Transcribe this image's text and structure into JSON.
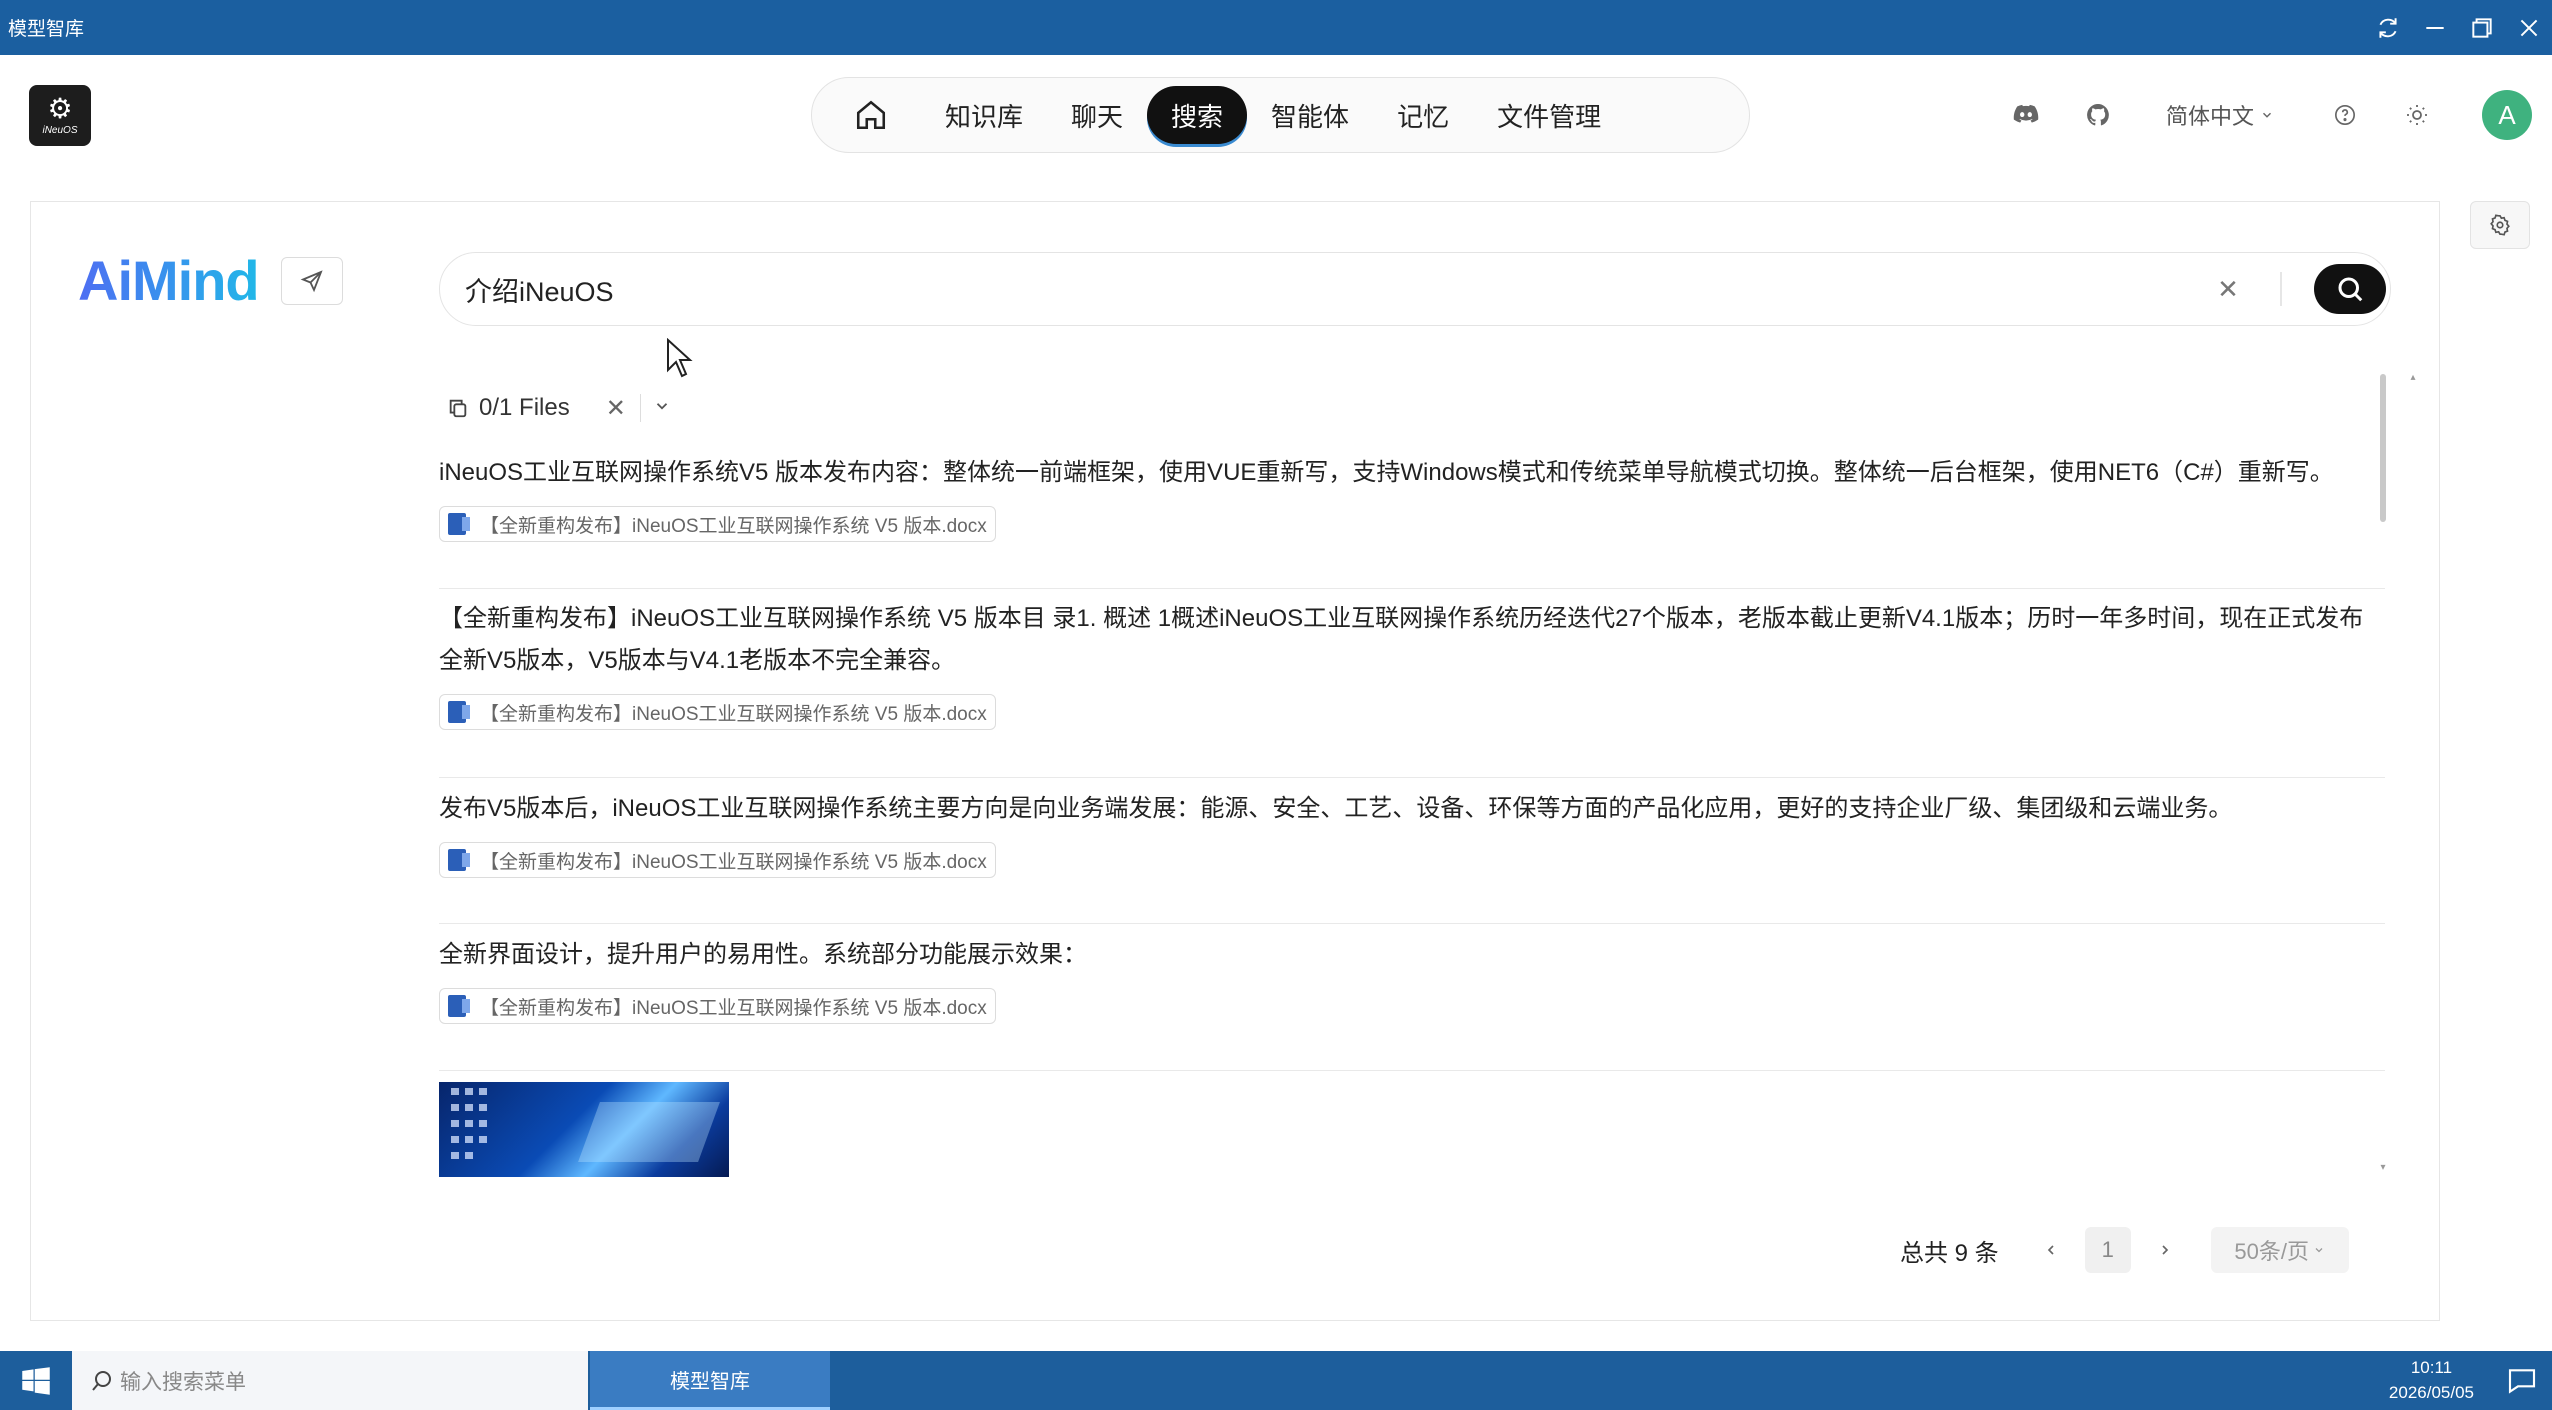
{
  "window": {
    "title": "模型智库",
    "controls": [
      "refresh-icon",
      "minimize-icon",
      "restore-icon",
      "close-icon"
    ]
  },
  "header": {
    "logo_text": "iNeuOS",
    "nav": [
      {
        "key": "home",
        "label": "",
        "icon": "home-icon",
        "active": false
      },
      {
        "key": "knowledge",
        "label": "知识库",
        "active": false
      },
      {
        "key": "chat",
        "label": "聊天",
        "active": false
      },
      {
        "key": "search",
        "label": "搜索",
        "active": true
      },
      {
        "key": "agents",
        "label": "智能体",
        "active": false
      },
      {
        "key": "memory",
        "label": "记忆",
        "active": false
      },
      {
        "key": "files",
        "label": "文件管理",
        "active": false
      }
    ],
    "language": "简体中文",
    "avatar_letter": "A"
  },
  "search": {
    "brand": "AiMind",
    "query": "介绍iNeuOS",
    "files_label": "0/1  Files"
  },
  "results": [
    {
      "text": "iNeuOS工业互联网操作系统V5 版本发布内容：整体统一前端框架，使用VUE重新写，支持Windows模式和传统菜单导航模式切换。整体统一后台框架，使用NET6（C#）重新写。",
      "doc": "【全新重构发布】iNeuOS工业互联网操作系统 V5 版本.docx"
    },
    {
      "text": "【全新重构发布】iNeuOS工业互联网操作系统 V5 版本目 录1. 概述 1概述iNeuOS工业互联网操作系统历经迭代27个版本，老版本截止更新V4.1版本；历时一年多时间，现在正式发布全新V5版本，V5版本与V4.1老版本不完全兼容。",
      "doc": "【全新重构发布】iNeuOS工业互联网操作系统 V5 版本.docx"
    },
    {
      "text": "发布V5版本后，iNeuOS工业互联网操作系统主要方向是向业务端发展：能源、安全、工艺、设备、环保等方面的产品化应用，更好的支持企业厂级、集团级和云端业务。",
      "doc": "【全新重构发布】iNeuOS工业互联网操作系统 V5 版本.docx"
    },
    {
      "text": "全新界面设计，提升用户的易用性。系统部分功能展示效果：",
      "doc": "【全新重构发布】iNeuOS工业互联网操作系统 V5 版本.docx"
    }
  ],
  "pagination": {
    "total": "总共 9 条",
    "page": "1",
    "page_size": "50条/页"
  },
  "taskbar": {
    "search_placeholder": "输入搜索菜单",
    "app": "模型智库",
    "time": "10:11",
    "date": "2026/05/05"
  },
  "colors": {
    "titlebar": "#1b5fa0",
    "taskbar": "#1d5e9c",
    "active_nav": "#111111",
    "brand_gradient_start": "#4e6ef2",
    "brand_gradient_end": "#21b8e8",
    "avatar": "#3fb27f"
  }
}
